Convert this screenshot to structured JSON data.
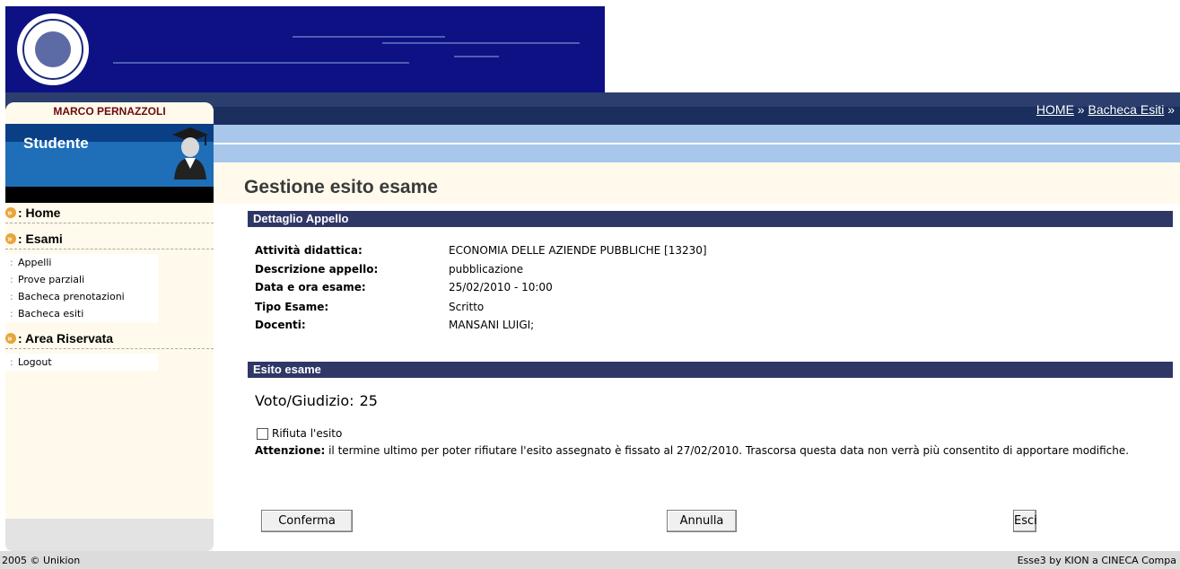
{
  "header": {
    "logo_icon": "university-seal-icon"
  },
  "breadcrumb": {
    "home": "HOME",
    "separator": "»",
    "current": "Bacheca Esiti",
    "trailing": "»"
  },
  "sidebar": {
    "user_name": "MARCO PERNAZZOLI",
    "role": "Studente",
    "role_icon": "graduate-icon",
    "sections": [
      {
        "label": ": Home",
        "items": []
      },
      {
        "label": ": Esami",
        "items": [
          "Appelli",
          "Prove parziali",
          "Bacheca prenotazioni",
          "Bacheca esiti"
        ]
      },
      {
        "label": ": Area Riservata",
        "items": [
          "Logout"
        ]
      }
    ]
  },
  "main": {
    "title": "Gestione esito esame",
    "detail_section": {
      "heading": "Dettaglio Appello",
      "rows": [
        {
          "label": "Attività didattica:",
          "value": "ECONOMIA DELLE AZIENDE PUBBLICHE [13230]"
        },
        {
          "label": "Descrizione appello:",
          "value": "pubblicazione"
        },
        {
          "label": "Data e ora esame:",
          "value": "25/02/2010 - 10:00"
        },
        {
          "label": "Tipo Esame:",
          "value": "Scritto"
        },
        {
          "label": "Docenti:",
          "value": "MANSANI LUIGI;"
        }
      ]
    },
    "result_section": {
      "heading": "Esito esame",
      "grade_label": "Voto/Giudizio:",
      "grade_value": "25",
      "refuse_label": "Rifiuta l'esito",
      "refuse_checked": false,
      "warning_bold": "Attenzione:",
      "warning_text": "il termine ultimo per poter rifiutare l'esito assegnato è fissato al 27/02/2010. Trascorsa questa data non verrà più consentito di apportare modifiche."
    },
    "buttons": {
      "confirm": "Conferma",
      "cancel": "Annulla",
      "exit": "Esci"
    }
  },
  "footer": {
    "left": "2005 © Unikion",
    "right": "Esse3 by KION a CINECA Compa"
  },
  "colors": {
    "banner": "#0d1183",
    "nav_strip": "#1b2f5e",
    "light_strip": "#a9c7ea",
    "section_bar": "#2f3766",
    "sidebar_bg": "#fffaec",
    "role_box": "#1e6fb8",
    "bullet": "#e9a43a"
  }
}
